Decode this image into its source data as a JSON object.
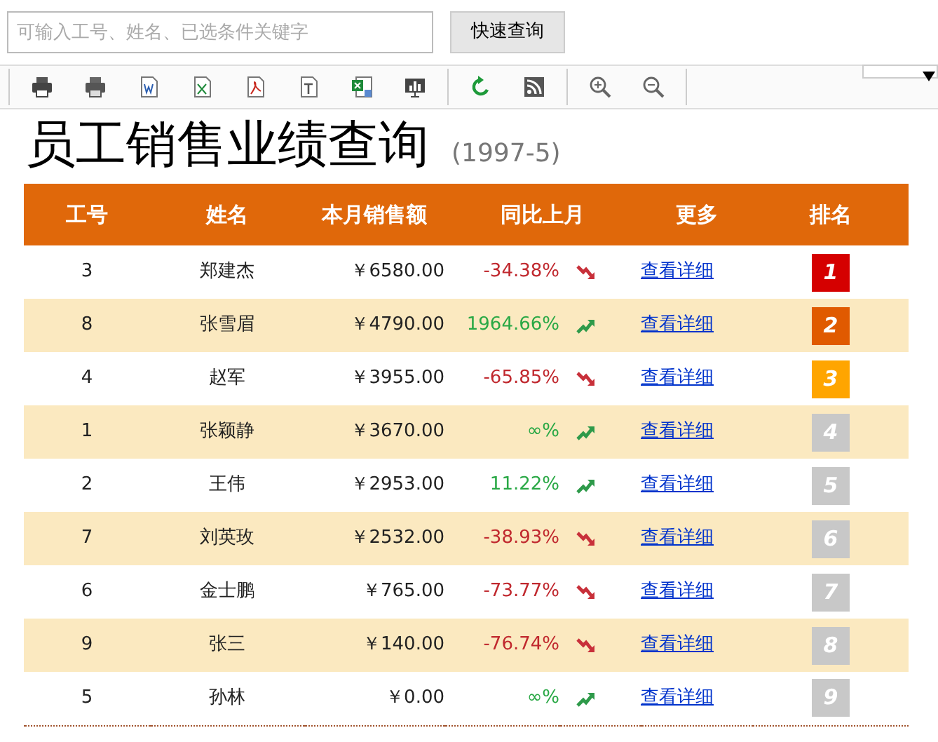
{
  "search": {
    "placeholder": "可输入工号、姓名、已选条件关键字",
    "button": "快速查询"
  },
  "toolbar": [
    {
      "kind": "print"
    },
    {
      "kind": "print2"
    },
    {
      "kind": "word"
    },
    {
      "kind": "excel"
    },
    {
      "kind": "pdf"
    },
    {
      "kind": "text"
    },
    {
      "kind": "excel2"
    },
    {
      "kind": "chart"
    },
    {
      "kind": "refresh"
    },
    {
      "kind": "rss"
    },
    {
      "kind": "zoomin"
    },
    {
      "kind": "zoomout"
    }
  ],
  "title": "员工销售业绩查询",
  "subtitle": "(1997-5)",
  "table": {
    "columns": [
      "工号",
      "姓名",
      "本月销售额",
      "同比上月",
      "更多",
      "排名"
    ],
    "rows": [
      {
        "id": "3",
        "name": "郑建杰",
        "sales": "￥6580.00",
        "change": "-34.38%",
        "kind": "down",
        "link": "查看详细",
        "rank": "1",
        "color": "#d50000"
      },
      {
        "id": "8",
        "name": "张雪眉",
        "sales": "￥4790.00",
        "change": "1964.66%",
        "kind": "up",
        "link": "查看详细",
        "rank": "2",
        "color": "#e05a00"
      },
      {
        "id": "4",
        "name": "赵军",
        "sales": "￥3955.00",
        "change": "-65.85%",
        "kind": "down",
        "link": "查看详细",
        "rank": "3",
        "color": "#ffa500"
      },
      {
        "id": "1",
        "name": "张颖静",
        "sales": "￥3670.00",
        "change": "∞%",
        "kind": "up",
        "link": "查看详细",
        "rank": "4",
        "color": "#c8c8c8"
      },
      {
        "id": "2",
        "name": "王伟",
        "sales": "￥2953.00",
        "change": "11.22%",
        "kind": "up",
        "link": "查看详细",
        "rank": "5",
        "color": "#c8c8c8"
      },
      {
        "id": "7",
        "name": "刘英玫",
        "sales": "￥2532.00",
        "change": "-38.93%",
        "kind": "down",
        "link": "查看详细",
        "rank": "6",
        "color": "#c8c8c8"
      },
      {
        "id": "6",
        "name": "金士鹏",
        "sales": "￥765.00",
        "change": "-73.77%",
        "kind": "down",
        "link": "查看详细",
        "rank": "7",
        "color": "#c8c8c8"
      },
      {
        "id": "9",
        "name": "张三",
        "sales": "￥140.00",
        "change": "-76.74%",
        "kind": "down",
        "link": "查看详细",
        "rank": "8",
        "color": "#c8c8c8"
      },
      {
        "id": "5",
        "name": "孙林",
        "sales": "￥0.00",
        "change": "∞%",
        "kind": "up",
        "link": "查看详细",
        "rank": "9",
        "color": "#c8c8c8"
      }
    ]
  }
}
